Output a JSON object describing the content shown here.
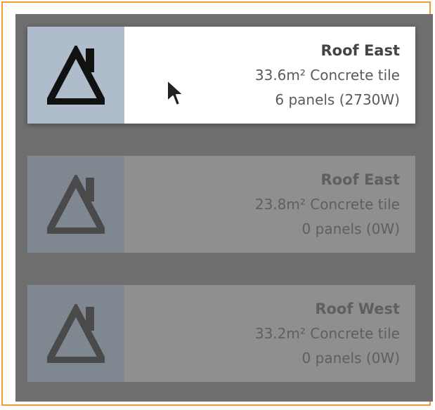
{
  "roofs": [
    {
      "name": "Roof East",
      "area_material": "33.6m² Concrete tile",
      "panels": "6 panels (2730W)",
      "state": "active"
    },
    {
      "name": "Roof East",
      "area_material": "23.8m² Concrete tile",
      "panels": "0 panels (0W)",
      "state": "dim"
    },
    {
      "name": "Roof West",
      "area_material": "33.2m² Concrete tile",
      "panels": "0 panels (0W)",
      "state": "dim"
    }
  ],
  "icons": {
    "roof": "house-roof-icon",
    "cursor": "mouse-pointer-icon"
  },
  "colors": {
    "frame_border": "#F29A3A",
    "panel_bg": "#6f6f6f",
    "active_thumb": "#aebccb"
  }
}
